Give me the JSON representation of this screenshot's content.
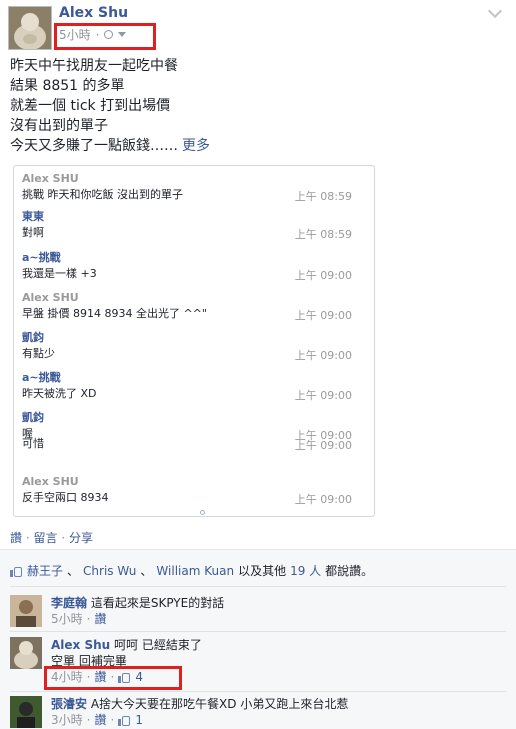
{
  "post": {
    "author": "Alex Shu",
    "time": "5小時",
    "body_lines": [
      "昨天中午找朋友一起吃中餐",
      "結果 8851 的多單",
      "就差一個 tick 打到出場價",
      "沒有出到的單子",
      "今天又多賺了一點飯錢……"
    ],
    "more_label": "更多"
  },
  "chat": {
    "messages": [
      {
        "sender": "Alex SHU",
        "text": "挑戰 昨天和你吃飯 沒出到的單子",
        "time": "上午 08:59",
        "color": "grey"
      },
      {
        "sender": "東東",
        "text": "對啊",
        "time": "上午 08:59",
        "color": "blue"
      },
      {
        "sender": "a~挑戰",
        "text": "我還是一樣 +3",
        "time": "上午 09:00",
        "color": "blue"
      },
      {
        "sender": "Alex SHU",
        "text": "早盤 掛價 8914 8934 全出光了 ^^\"",
        "time": "上午 09:00",
        "color": "grey"
      },
      {
        "sender": "凱鈞",
        "text": "有點少",
        "time": "上午 09:00",
        "color": "blue"
      },
      {
        "sender": "a~挑戰",
        "text": "昨天被洗了 XD",
        "time": "上午 09:00",
        "color": "blue"
      },
      {
        "sender": "凱鈞",
        "text": "喔",
        "time": "上午 09:00",
        "color": "blue"
      },
      {
        "sender": "",
        "text": "可惜",
        "time": "上午 09:00",
        "color": "blue"
      },
      {
        "sender": "Alex SHU",
        "text": "反手空兩口 8934",
        "time": "上午 09:00",
        "color": "grey"
      }
    ]
  },
  "actions": {
    "like": "讚",
    "comment": "留言",
    "share": "分享",
    "sep": "·"
  },
  "likes": {
    "names": [
      "赫王子",
      "Chris Wu",
      "William Kuan"
    ],
    "sep": "、",
    "connector": "以及其他",
    "others": "19 人",
    "suffix": "都說讚。"
  },
  "comments": [
    {
      "name": "李庭翰",
      "text": "這看起來是SKPYE的對話",
      "text2": "",
      "time": "5小時",
      "like_label": "讚",
      "like_count": ""
    },
    {
      "name": "Alex Shu",
      "text": "呵呵 已經結束了",
      "text2": "空單 回補完畢",
      "time": "4小時",
      "like_label": "讚",
      "like_count": "4"
    },
    {
      "name": "張濬安",
      "text": "A捨大今天要在那吃午餐XD 小弟又跑上來台北惹",
      "text2": "",
      "time": "3小時",
      "like_label": "讚",
      "like_count": "1"
    }
  ],
  "colors": {
    "link": "#3b5998",
    "highlight": "#e02020",
    "meta": "#90949c"
  }
}
